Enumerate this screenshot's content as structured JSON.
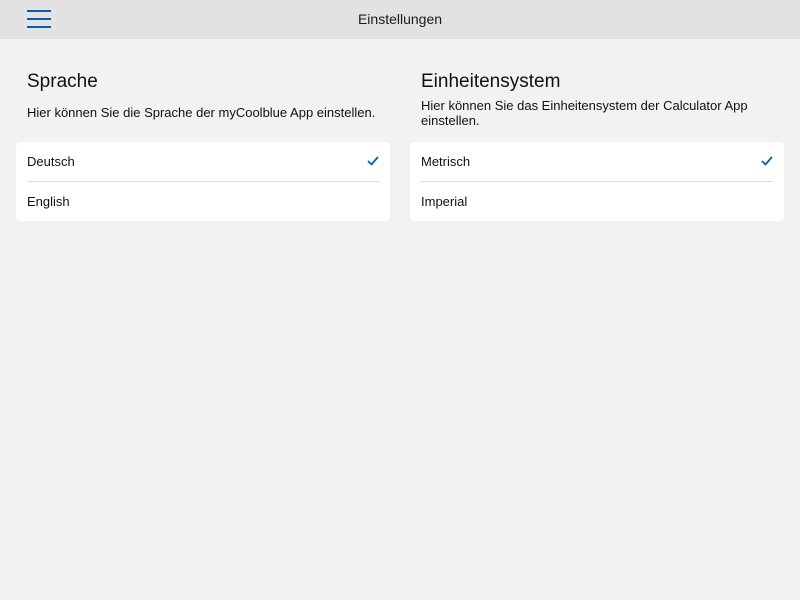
{
  "header": {
    "title": "Einstellungen",
    "menu_icon": "hamburger-menu-icon"
  },
  "colors": {
    "accent": "#0b5fb0",
    "background": "#f2f2f2",
    "header_bg": "#e2e2e2",
    "card_bg": "#ffffff"
  },
  "language": {
    "title": "Sprache",
    "description": "Hier können Sie die Sprache der myCoolblue App einstellen.",
    "options": [
      {
        "label": "Deutsch",
        "selected": true
      },
      {
        "label": "English",
        "selected": false
      }
    ]
  },
  "units": {
    "title": "Einheitensystem",
    "description": "Hier können Sie das Einheitensystem der Calculator App einstellen.",
    "options": [
      {
        "label": "Metrisch",
        "selected": true
      },
      {
        "label": "Imperial",
        "selected": false
      }
    ]
  }
}
